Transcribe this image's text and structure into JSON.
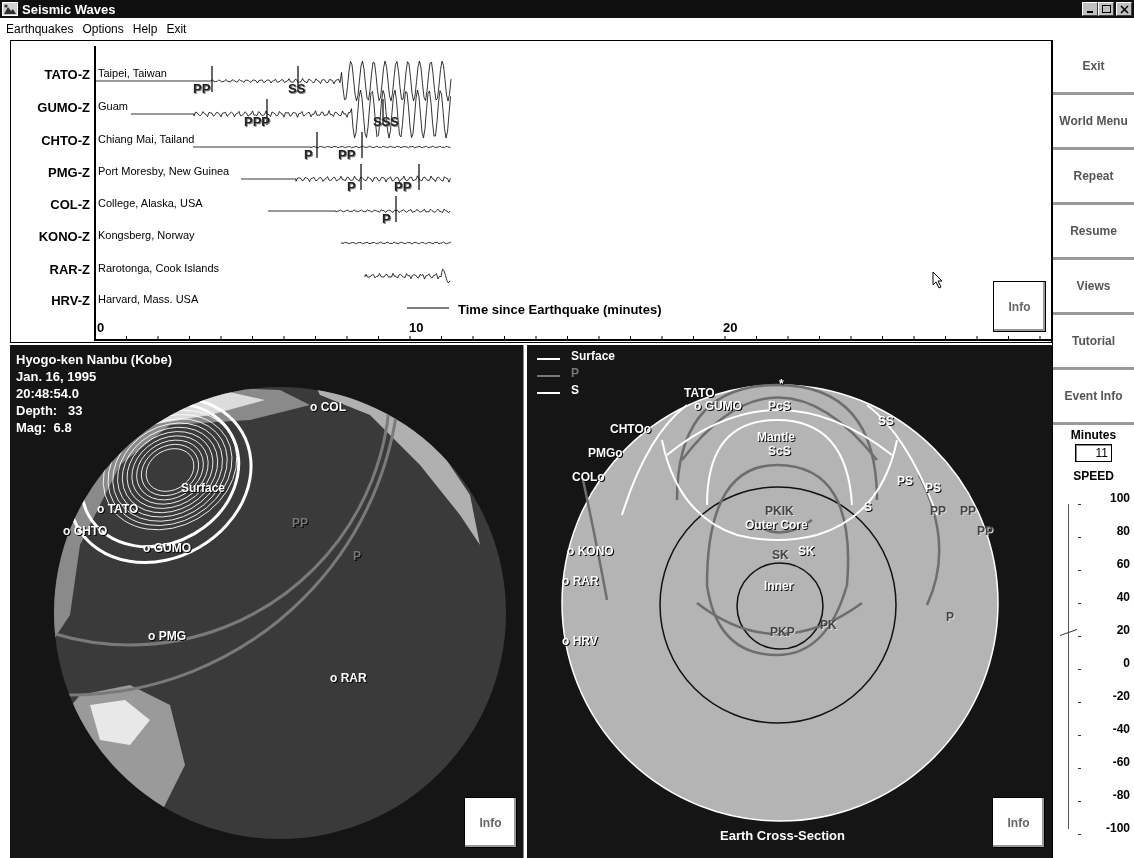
{
  "window": {
    "title": "Seismic Waves"
  },
  "menu": [
    {
      "label": "Earthquakes"
    },
    {
      "label": "Options"
    },
    {
      "label": "Help"
    },
    {
      "label": "Exit"
    }
  ],
  "seismograms": {
    "stations": [
      {
        "code": "TATO-Z",
        "place": "Taipei, Taiwan",
        "phases": [
          "PP",
          "SS"
        ]
      },
      {
        "code": "GUMO-Z",
        "place": "Guam",
        "phases": [
          "PPP",
          "SSS"
        ]
      },
      {
        "code": "CHTO-Z",
        "place": "Chiang Mai, Tailand",
        "phases": [
          "P",
          "PP"
        ]
      },
      {
        "code": "PMG-Z",
        "place": "Port Moresby, New Guinea",
        "phases": [
          "P",
          "PP"
        ]
      },
      {
        "code": "COL-Z",
        "place": "College, Alaska, USA",
        "phases": [
          "P"
        ]
      },
      {
        "code": "KONO-Z",
        "place": "Kongsberg, Norway"
      },
      {
        "code": "RAR-Z",
        "place": "Rarotonga, Cook Islands"
      },
      {
        "code": "HRV-Z",
        "place": "Harvard, Mass. USA"
      }
    ],
    "time_axis_label": "Time since Earthquake (minutes)",
    "axis_labels": [
      "0",
      "10",
      "20"
    ],
    "info_button": "Info"
  },
  "globe": {
    "event_lines": [
      "Hyogo-ken Nanbu (Kobe)",
      "Jan. 16, 1995",
      "20:48:54.0",
      "Depth:   33",
      "Mag:  6.8"
    ],
    "labels": [
      {
        "text": "o COL",
        "kind": "station"
      },
      {
        "text": "Surface",
        "kind": "s"
      },
      {
        "text": "o TATO",
        "kind": "station"
      },
      {
        "text": "o CHTO",
        "kind": "station"
      },
      {
        "text": "o GUMO",
        "kind": "station"
      },
      {
        "text": "PP",
        "kind": "p"
      },
      {
        "text": "P",
        "kind": "p"
      },
      {
        "text": "o PMG",
        "kind": "station"
      },
      {
        "text": "o RAR",
        "kind": "station"
      }
    ],
    "info_button": "Info"
  },
  "cross_section": {
    "legend": [
      {
        "label": "Surface",
        "kind": "surface"
      },
      {
        "label": "P",
        "kind": "p"
      },
      {
        "label": "S",
        "kind": "s"
      }
    ],
    "labels": [
      {
        "text": "TATO",
        "kind": "station"
      },
      {
        "text": "o GUMO",
        "kind": "station"
      },
      {
        "text": "*",
        "kind": "station"
      },
      {
        "text": "PcS",
        "kind": "s"
      },
      {
        "text": "SS",
        "kind": "s"
      },
      {
        "text": "CHTOo",
        "kind": "station"
      },
      {
        "text": "PMGo",
        "kind": "station"
      },
      {
        "text": "COLo",
        "kind": "station"
      },
      {
        "text": "Mantle",
        "kind": "s"
      },
      {
        "text": "ScS",
        "kind": "s"
      },
      {
        "text": "PS",
        "kind": "s"
      },
      {
        "text": "PS",
        "kind": "s"
      },
      {
        "text": "PP",
        "kind": "p"
      },
      {
        "text": "PP",
        "kind": "p"
      },
      {
        "text": "PP",
        "kind": "p"
      },
      {
        "text": "PKIK",
        "kind": "p"
      },
      {
        "text": "Outer Core",
        "kind": "s"
      },
      {
        "text": "S",
        "kind": "s"
      },
      {
        "text": "SK",
        "kind": "p"
      },
      {
        "text": "SK",
        "kind": "s"
      },
      {
        "text": "Inner",
        "kind": "s"
      },
      {
        "text": "PKP",
        "kind": "p"
      },
      {
        "text": "PK",
        "kind": "p"
      },
      {
        "text": "o KONO",
        "kind": "station"
      },
      {
        "text": "o RAR",
        "kind": "station"
      },
      {
        "text": "o HRV",
        "kind": "station"
      },
      {
        "text": "P",
        "kind": "p"
      }
    ],
    "caption": "Earth Cross-Section",
    "info_button": "Info"
  },
  "sidebar": {
    "buttons": [
      "Exit",
      "World Menu",
      "Repeat",
      "Resume",
      "Views",
      "Tutorial",
      "Event Info"
    ],
    "minutes_label": "Minutes",
    "minutes_value": "11",
    "speed_label": "SPEED",
    "speed_scale": [
      "100",
      "80",
      "60",
      "40",
      "20",
      "0",
      "-20",
      "-40",
      "-60",
      "-80",
      "-100"
    ],
    "speed": {
      "level": 0.6
    }
  }
}
